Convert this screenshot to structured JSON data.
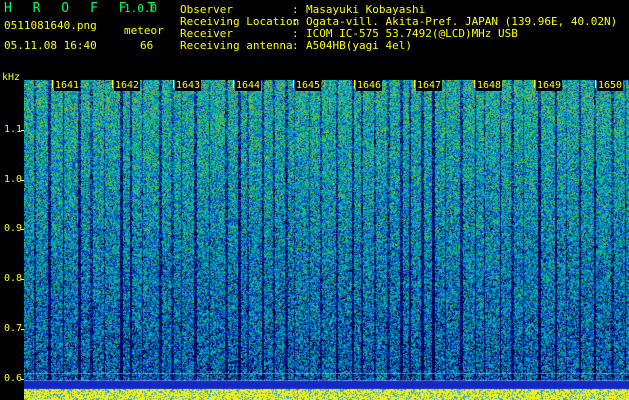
{
  "header": {
    "app_title": "H R O F F T",
    "app_version": "1.0.0",
    "file_name": "0511081640.png",
    "meteor_label": "meteor",
    "timestamp": "05.11.08 16:40",
    "meteor_count": "66",
    "info": [
      {
        "label": "Observer",
        "value": "Masayuki Kobayashi"
      },
      {
        "label": "Receiving Location",
        "value": "Ogata-vill. Akita-Pref. JAPAN (139.96E, 40.02N)"
      },
      {
        "label": "Receiver",
        "value": "ICOM IC-575 53.7492(@LCD)MHz USB"
      },
      {
        "label": "Receiving antenna",
        "value": "A504HB(yagi 4el)"
      }
    ],
    "separator": ":"
  },
  "axis": {
    "unit": "kHz",
    "ticks": [
      "1.1",
      "1.0",
      "0.9",
      "0.8",
      "0.7",
      "0.6"
    ],
    "minutes": [
      "1641",
      "1642",
      "1643",
      "1644",
      "1645",
      "1646",
      "1647",
      "1648",
      "1649",
      "1650"
    ]
  },
  "colors": {
    "text_primary": "#ffff00",
    "text_secondary": "#00ff66",
    "background": "#000000"
  }
}
